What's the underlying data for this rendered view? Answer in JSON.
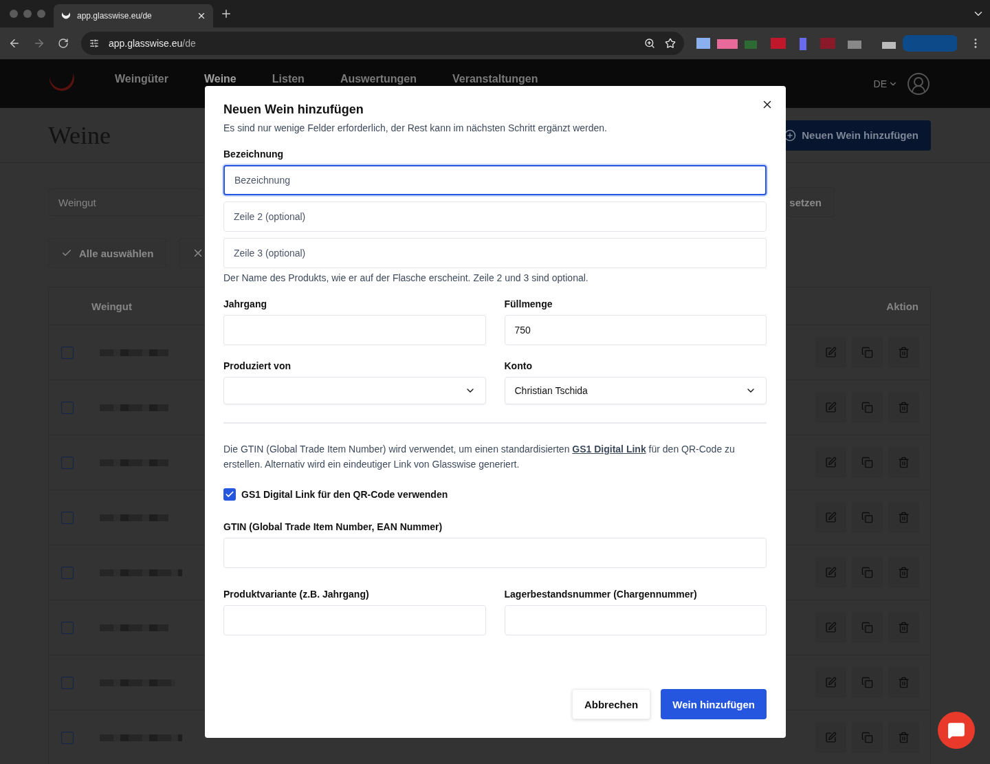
{
  "browser": {
    "tab_title": "app.glasswise.eu/de",
    "url_host": "app.glasswise.eu",
    "url_path": "/de"
  },
  "nav": {
    "items": [
      {
        "label": "Weingüter",
        "selected": false
      },
      {
        "label": "Weine",
        "selected": true
      },
      {
        "label": "Listen",
        "selected": false
      },
      {
        "label": "Auswertungen",
        "selected": false
      },
      {
        "label": "Veranstaltungen",
        "selected": false
      }
    ],
    "language": "DE"
  },
  "page": {
    "title": "Weine",
    "add_button": "Neuen Wein hinzufügen",
    "filter_placeholder": "Weingut",
    "reset_button": "setzen",
    "select_all_button": "Alle auswählen",
    "table": {
      "columns": [
        "Weingut",
        "Aktion"
      ],
      "rows": [
        {
          "checked": false
        },
        {
          "checked": false
        },
        {
          "checked": false
        },
        {
          "checked": false
        },
        {
          "checked": false
        },
        {
          "checked": false
        },
        {
          "checked": false
        },
        {
          "checked": false
        }
      ]
    }
  },
  "modal": {
    "title": "Neuen Wein hinzufügen",
    "subtitle": "Es sind nur wenige Felder erforderlich, der Rest kann im nächsten Schritt ergänzt werden.",
    "name_label": "Bezeichnung",
    "name_inputs": [
      {
        "placeholder": "Bezeichnung",
        "focused": true
      },
      {
        "placeholder": "Zeile 2 (optional)",
        "focused": false
      },
      {
        "placeholder": "Zeile 3 (optional)",
        "focused": false
      }
    ],
    "name_hint": "Der Name des Produkts, wie er auf der Flasche erscheint. Zeile 2 und 3 sind optional.",
    "fields": [
      {
        "label": "Jahrgang",
        "kind": "text"
      },
      {
        "label": "Füllmenge",
        "kind": "text",
        "value": "750"
      },
      {
        "label": "Produziert von",
        "kind": "select"
      },
      {
        "label": "Konto",
        "kind": "select",
        "value": "Christian Tschida"
      }
    ],
    "gtin_info_before": "Die GTIN (Global Trade Item Number) wird verwendet, um einen standardisierten",
    "gtin_info_link": "GS1 Digital Link",
    "gtin_info_after": "für den QR-Code zu erstellen. Alternativ wird ein eindeutiger Link von Glasswise generiert.",
    "gs1_checkbox": {
      "label": "GS1 Digital Link für den QR-Code verwenden",
      "checked": true
    },
    "gtin_field": {
      "label": "GTIN (Global Trade Item Number, EAN Nummer)",
      "kind": "text"
    },
    "extra_fields": [
      {
        "label": "Produktvariante (z.B. Jahrgang)",
        "kind": "text"
      },
      {
        "label": "Lagerbestandsnummer (Chargennummer)",
        "kind": "text"
      }
    ],
    "cancel_button": "Abbrechen",
    "submit_button": "Wein hinzufügen"
  }
}
